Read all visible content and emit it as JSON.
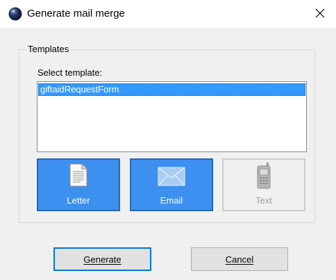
{
  "window": {
    "title": "Generate mail merge",
    "app_icon": "globe-orb-icon",
    "close_icon": "close-icon"
  },
  "templates_group": {
    "legend": "Templates",
    "select_label": "Select template:",
    "items": [
      "giftaidRequestForm"
    ],
    "selected_index": 0
  },
  "type_buttons": {
    "letter": {
      "label": "Letter",
      "icon": "document-icon",
      "state": "selected"
    },
    "email": {
      "label": "Email",
      "icon": "envelope-icon",
      "state": "selected"
    },
    "text": {
      "label": "Text",
      "icon": "mobile-phone-icon",
      "state": "disabled"
    }
  },
  "actions": {
    "generate_label": "Generate",
    "cancel_label": "Cancel"
  },
  "colors": {
    "selection": "#3399ff",
    "button_active": "#3d8ff0",
    "default_button_border": "#0078d7"
  }
}
